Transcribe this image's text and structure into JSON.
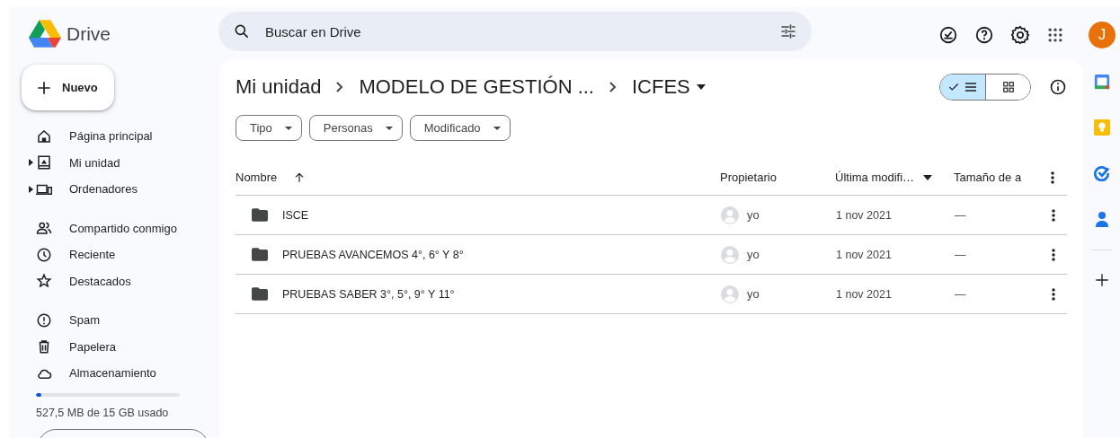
{
  "app": {
    "name": "Drive"
  },
  "search": {
    "placeholder": "Buscar en Drive"
  },
  "account": {
    "initial": "J"
  },
  "new_button": {
    "label": "Nuevo"
  },
  "sidebar": {
    "sections": [
      [
        {
          "label": "Página principal",
          "expandable": false
        },
        {
          "label": "Mi unidad",
          "expandable": true
        },
        {
          "label": "Ordenadores",
          "expandable": true
        }
      ],
      [
        {
          "label": "Compartido conmigo",
          "expandable": false
        },
        {
          "label": "Reciente",
          "expandable": false
        },
        {
          "label": "Destacados",
          "expandable": false
        }
      ],
      [
        {
          "label": "Spam",
          "expandable": false
        },
        {
          "label": "Papelera",
          "expandable": false
        },
        {
          "label": "Almacenamiento",
          "expandable": false
        }
      ]
    ]
  },
  "storage": {
    "level": 0.035,
    "text": "527,5 MB de 15 GB usado"
  },
  "breadcrumb": [
    {
      "label": "Mi unidad",
      "current": false
    },
    {
      "label": "MODELO DE GESTIÓN ...",
      "current": false
    },
    {
      "label": "ICFES",
      "current": true
    }
  ],
  "view_toggle": [
    {
      "kind": "list",
      "selected": true
    },
    {
      "kind": "grid",
      "selected": false
    }
  ],
  "filters": [
    {
      "label": "Tipo"
    },
    {
      "label": "Personas"
    },
    {
      "label": "Modificado"
    }
  ],
  "table": {
    "columns": [
      {
        "label": "Nombre",
        "kind": "sorted"
      },
      {
        "label": "Propietario",
        "kind": "plain"
      },
      {
        "label": "Última modifi…",
        "kind": "dropdown"
      },
      {
        "label": "Tamaño de a",
        "kind": "plain"
      }
    ],
    "rows": [
      {
        "name": "ISCE",
        "owner": "yo",
        "modified": "1 nov 2021",
        "size": "—"
      },
      {
        "name": "PRUEBAS AVANCEMOS 4°, 6° Y 8°",
        "owner": "yo",
        "modified": "1 nov 2021",
        "size": "—"
      },
      {
        "name": "PRUEBAS SABER 3°, 5°, 9° Y 11°",
        "owner": "yo",
        "modified": "1 nov 2021",
        "size": "—"
      }
    ]
  }
}
